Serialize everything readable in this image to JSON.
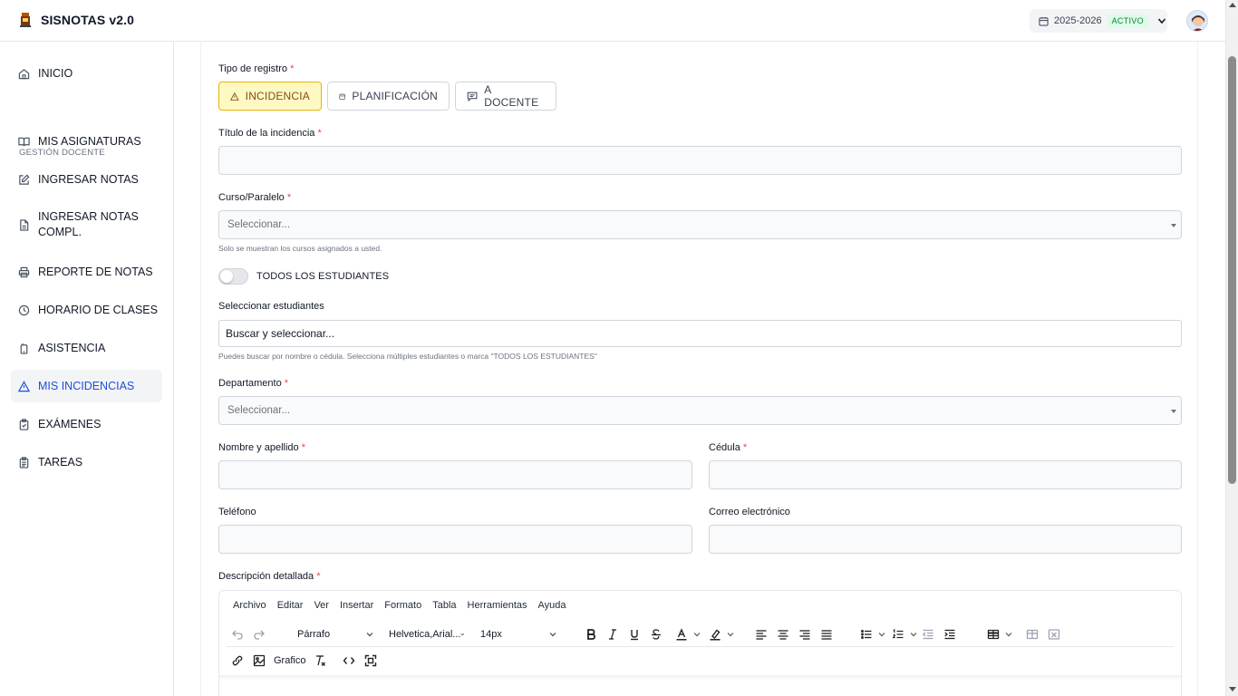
{
  "app": {
    "title": "SISNOTAS v2.0"
  },
  "header": {
    "year": "2025-2026",
    "status": "ACTIVO"
  },
  "sidebar": {
    "section_label": "GESTIÓN DOCENTE",
    "items": [
      {
        "label": "INICIO",
        "icon": "home-icon"
      },
      {
        "label": "MIS ASIGNATURAS",
        "icon": "book-icon"
      },
      {
        "label": "INGRESAR NOTAS",
        "icon": "edit-icon"
      },
      {
        "label": "INGRESAR NOTAS COMPL.",
        "icon": "file-icon"
      },
      {
        "label": "REPORTE DE NOTAS",
        "icon": "printer-icon"
      },
      {
        "label": "HORARIO DE CLASES",
        "icon": "clock-icon"
      },
      {
        "label": "ASISTENCIA",
        "icon": "phone-icon"
      },
      {
        "label": "MIS INCIDENCIAS",
        "icon": "alert-triangle-icon",
        "active": true
      },
      {
        "label": "EXÁMENES",
        "icon": "clipboard-check-icon"
      },
      {
        "label": "TAREAS",
        "icon": "clipboard-list-icon"
      }
    ]
  },
  "form": {
    "type_label": "Tipo de registro",
    "types": [
      {
        "label": "INCIDENCIA",
        "icon": "alert-triangle-icon",
        "selected": true
      },
      {
        "label": "PLANIFICACIÓN",
        "icon": "calendar-icon"
      },
      {
        "label": "A DOCENTE",
        "icon": "message-icon"
      }
    ],
    "title_label": "Título de la incidencia",
    "title_value": "",
    "course_label": "Curso/Paralelo",
    "course_placeholder": "Seleccionar...",
    "course_hint": "Solo se muestran los cursos asignados a usted.",
    "all_students_label": "TODOS LOS ESTUDIANTES",
    "all_students_on": false,
    "students_label": "Seleccionar estudiantes",
    "students_placeholder": "Buscar y seleccionar...",
    "students_hint": "Puedes buscar por nombre o cédula. Selecciona múltiples estudiantes o marca \"TODOS LOS ESTUDIANTES\"",
    "department_label": "Departamento",
    "department_placeholder": "Seleccionar...",
    "name_label": "Nombre y apellido",
    "id_label": "Cédula",
    "phone_label": "Teléfono",
    "email_label": "Correo electrónico",
    "description_label": "Descripción detallada",
    "required_mark": "*"
  },
  "editor": {
    "menu": [
      "Archivo",
      "Editar",
      "Ver",
      "Insertar",
      "Formato",
      "Tabla",
      "Herramientas",
      "Ayuda"
    ],
    "block_format": "Párrafo",
    "font_family": "Helvetica,Arial...",
    "font_size": "14px",
    "chart_label": "Grafico"
  }
}
